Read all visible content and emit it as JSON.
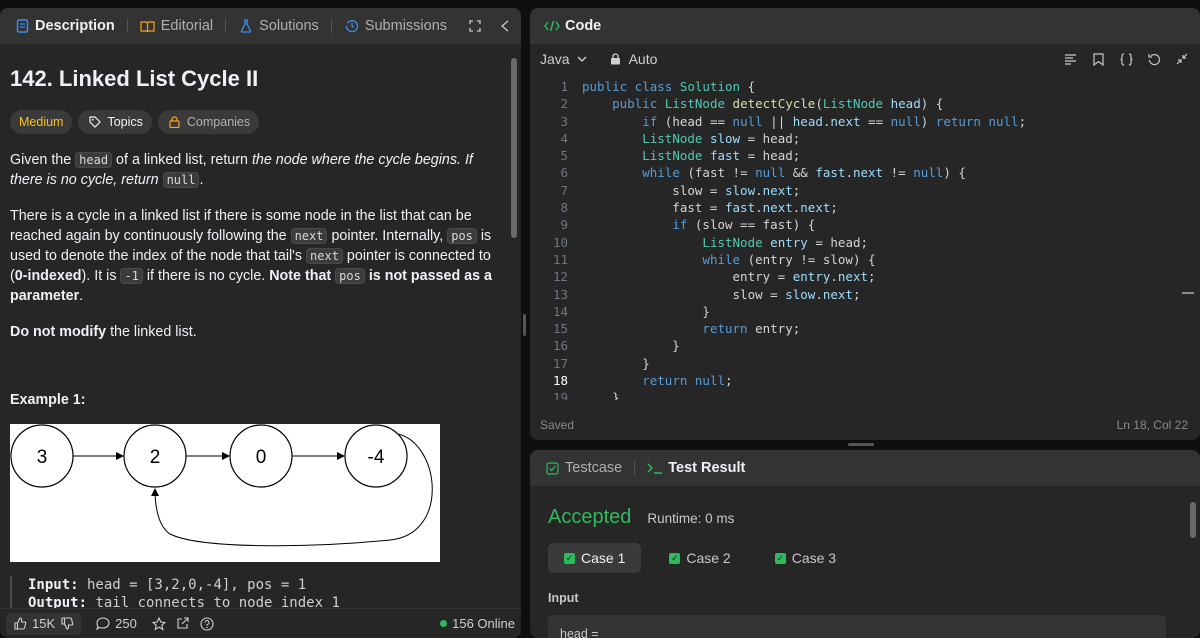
{
  "left_tabs": [
    {
      "label": "Description",
      "icon": "description-icon"
    },
    {
      "label": "Editorial",
      "icon": "book-icon"
    },
    {
      "label": "Solutions",
      "icon": "flask-icon"
    },
    {
      "label": "Submissions",
      "icon": "history-icon"
    }
  ],
  "problem": {
    "title": "142. Linked List Cycle II",
    "difficulty": "Medium",
    "topics_label": "Topics",
    "companies_label": "Companies",
    "p1": {
      "a": "Given the ",
      "code_head": "head",
      "b": " of a linked list, return ",
      "em": "the node where the cycle begins. If there is no cycle, return ",
      "code_null": "null",
      "c": "."
    },
    "p2": {
      "a": "There is a cycle in a linked list if there is some node in the list that can be reached again by continuously following the ",
      "code_next": "next",
      "b": " pointer. Internally, ",
      "code_pos": "pos",
      "c": " is used to denote the index of the node that tail's ",
      "code_next2": "next",
      "d": " pointer is connected to (",
      "bold1": "0-indexed",
      "e": "). It is ",
      "code_neg": "-1",
      "f": " if there is no cycle. ",
      "bold2": "Note that ",
      "code_pos2": "pos",
      "bold3": " is not passed as a parameter",
      "g": "."
    },
    "p3": {
      "bold": "Do not modify",
      "rest": " the linked list."
    },
    "example_title": "Example 1:",
    "diagram_nodes": [
      "3",
      "2",
      "0",
      "-4"
    ],
    "input_label": "Input:",
    "input_value": " head = [3,2,0,-4], pos = 1",
    "output_label": "Output:",
    "output_value": " tail connects to node index 1"
  },
  "footer": {
    "likes": "15K",
    "comments": "250",
    "online": "156 Online"
  },
  "code_panel": {
    "title": "Code",
    "language": "Java",
    "auto_label": "Auto",
    "status_left": "Saved",
    "status_right": "Ln 18, Col 22",
    "current_line": 18
  },
  "result_panel": {
    "testcase_tab": "Testcase",
    "result_tab": "Test Result",
    "verdict": "Accepted",
    "runtime": "Runtime: 0 ms",
    "cases": [
      "Case 1",
      "Case 2",
      "Case 3"
    ],
    "active_case": 0,
    "input_label": "Input",
    "input_value": "head ="
  },
  "colors": {
    "accent_green": "#2cbb5d",
    "medium_yellow": "#ffc01e",
    "panel_bg": "#262626"
  }
}
